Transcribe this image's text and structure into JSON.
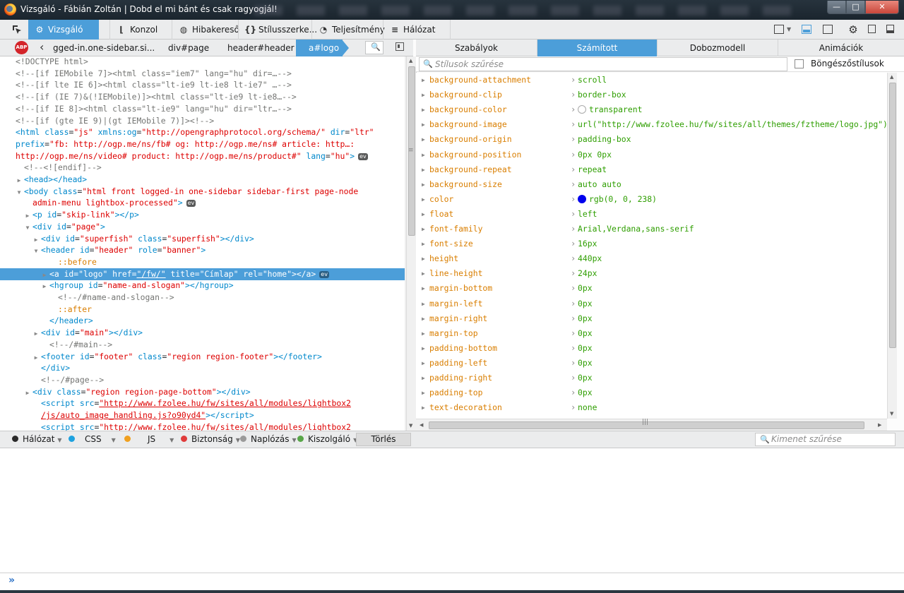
{
  "window": {
    "title": "Vizsgáló - Fábián Zoltán | Dobd el mi bánt és csak ragyogjál!",
    "buttons": {
      "minimize": "—",
      "maximize": "□",
      "close": "✕"
    }
  },
  "toolbar": {
    "tabs": [
      {
        "label": "Vizsgáló",
        "icon": "inspector-icon"
      },
      {
        "label": "Konzol",
        "icon": "console-icon"
      },
      {
        "label": "Hibakereső",
        "icon": "debugger-icon"
      },
      {
        "label": "Stílusszerke...",
        "icon": "style-editor-icon"
      },
      {
        "label": "Teljesítmény",
        "icon": "performance-icon"
      },
      {
        "label": "Hálózat",
        "icon": "network-icon"
      }
    ]
  },
  "breadcrumbs": {
    "items": [
      "gged-in.one-sidebar.si...",
      "div#page",
      "header#header",
      "a#logo"
    ]
  },
  "markup": {
    "lines": [
      {
        "indent": 0,
        "tw": "",
        "html": "<span class=\"cm\">&lt;!DOCTYPE html&gt;</span>"
      },
      {
        "indent": 0,
        "tw": "",
        "html": "<span class=\"cm\">&lt;!--[if IEMobile 7]&gt;&lt;html class=\"iem7\" lang=\"hu\" dir=…--&gt;</span>"
      },
      {
        "indent": 0,
        "tw": "",
        "html": "<span class=\"cm\">&lt;!--[if lte IE 6]&gt;&lt;html class=\"lt-ie9 lt-ie8 lt-ie7\" …--&gt;</span>"
      },
      {
        "indent": 0,
        "tw": "",
        "html": "<span class=\"cm\">&lt;!--[if (IE 7)&amp;(!IEMobile)]&gt;&lt;html class=\"lt-ie9 lt-ie8…--&gt;</span>"
      },
      {
        "indent": 0,
        "tw": "",
        "html": "<span class=\"cm\">&lt;!--[if IE 8]&gt;&lt;html class=\"lt-ie9\" lang=\"hu\" dir=\"ltr…--&gt;</span>"
      },
      {
        "indent": 0,
        "tw": "",
        "html": "<span class=\"cm\">&lt;!--[if (gte IE 9)|(gt IEMobile 7)]&gt;&lt;!--&gt;</span>"
      },
      {
        "indent": 0,
        "tw": "",
        "html": "<span class=\"tag\">&lt;html</span> <span class=\"an\">class</span>=<span class=\"av\">\"js\"</span> <span class=\"an\">xmlns:og</span>=<span class=\"av\">\"http://opengraphprotocol.org/schema/\"</span> <span class=\"an\">dir</span>=<span class=\"av\">\"ltr\"</span>"
      },
      {
        "indent": 0,
        "tw": "",
        "html": "<span class=\"an\">prefix</span>=<span class=\"av\">\"fb: http://ogp.me/ns/fb# og: http://ogp.me/ns# article: http…:</span>"
      },
      {
        "indent": 0,
        "tw": "",
        "html": "<span class=\"av\">http://ogp.me/ns/video# product: http://ogp.me/ns/product#\"</span> <span class=\"an\">lang</span>=<span class=\"av\">\"hu\"</span><span class=\"tag\">&gt;</span><span class=\"ev\">ev</span>"
      },
      {
        "indent": 1,
        "tw": "",
        "html": "<span class=\"cm\">&lt;!--&lt;![endif]--&gt;</span>"
      },
      {
        "indent": 1,
        "tw": "▶",
        "html": "<span class=\"tag\">&lt;head&gt;&lt;/head&gt;</span>"
      },
      {
        "indent": 1,
        "tw": "▼",
        "html": "<span class=\"tag\">&lt;body</span> <span class=\"an\">class</span>=<span class=\"av\">\"html front logged-in one-sidebar sidebar-first page-node</span>"
      },
      {
        "indent": 2,
        "tw": "",
        "html": "<span class=\"av\">admin-menu lightbox-processed\"</span><span class=\"tag\">&gt;</span><span class=\"ev\">ev</span>"
      },
      {
        "indent": 2,
        "tw": "▶",
        "html": "<span class=\"tag\">&lt;p</span> <span class=\"an\">id</span>=<span class=\"av\">\"skip-link\"</span><span class=\"tag\">&gt;&lt;/p&gt;</span>"
      },
      {
        "indent": 2,
        "tw": "▼",
        "html": "<span class=\"tag\">&lt;div</span> <span class=\"an\">id</span>=<span class=\"av\">\"page\"</span><span class=\"tag\">&gt;</span>"
      },
      {
        "indent": 3,
        "tw": "▶",
        "html": "<span class=\"tag\">&lt;div</span> <span class=\"an\">id</span>=<span class=\"av\">\"superfish\"</span> <span class=\"an\">class</span>=<span class=\"av\">\"superfish\"</span><span class=\"tag\">&gt;&lt;/div&gt;</span>"
      },
      {
        "indent": 3,
        "tw": "▼",
        "html": "<span class=\"tag\">&lt;header</span> <span class=\"an\">id</span>=<span class=\"av\">\"header\"</span> <span class=\"an\">role</span>=<span class=\"av\">\"banner\"</span><span class=\"tag\">&gt;</span>"
      },
      {
        "indent": 5,
        "tw": "",
        "html": "<span class=\"pseudo\">::before</span>"
      },
      {
        "indent": 4,
        "tw": "▶",
        "sel": true,
        "html": "<span class=\"tag\">&lt;a</span> <span class=\"an\">id</span>=<span class=\"av\">\"logo\"</span> <span class=\"an\">href</span>=<span class=\"link\">\"/fw/\"</span> <span class=\"an\">title</span>=<span class=\"av\">\"Címlap\"</span> <span class=\"an\">rel</span>=<span class=\"av\">\"home\"</span><span class=\"tag\">&gt;&lt;/a&gt;</span><span class=\"ev\">ev</span>"
      },
      {
        "indent": 4,
        "tw": "▶",
        "html": "<span class=\"tag\">&lt;hgroup</span> <span class=\"an\">id</span>=<span class=\"av\">\"name-and-slogan\"</span><span class=\"tag\">&gt;&lt;/hgroup&gt;</span>"
      },
      {
        "indent": 5,
        "tw": "",
        "html": "<span class=\"cm\">&lt;!--/#name-and-slogan--&gt;</span>"
      },
      {
        "indent": 5,
        "tw": "",
        "html": "<span class=\"pseudo\">::after</span>"
      },
      {
        "indent": 4,
        "tw": "",
        "html": "<span class=\"tag\">&lt;/header&gt;</span>"
      },
      {
        "indent": 3,
        "tw": "▶",
        "html": "<span class=\"tag\">&lt;div</span> <span class=\"an\">id</span>=<span class=\"av\">\"main\"</span><span class=\"tag\">&gt;&lt;/div&gt;</span>"
      },
      {
        "indent": 4,
        "tw": "",
        "html": "<span class=\"cm\">&lt;!--/#main--&gt;</span>"
      },
      {
        "indent": 3,
        "tw": "▶",
        "html": "<span class=\"tag\">&lt;footer</span> <span class=\"an\">id</span>=<span class=\"av\">\"footer\"</span> <span class=\"an\">class</span>=<span class=\"av\">\"region region-footer\"</span><span class=\"tag\">&gt;&lt;/footer&gt;</span>"
      },
      {
        "indent": 3,
        "tw": "",
        "html": "<span class=\"tag\">&lt;/div&gt;</span>"
      },
      {
        "indent": 3,
        "tw": "",
        "html": "<span class=\"cm\">&lt;!--/#page--&gt;</span>"
      },
      {
        "indent": 2,
        "tw": "▶",
        "html": "<span class=\"tag\">&lt;div</span> <span class=\"an\">class</span>=<span class=\"av\">\"region region-page-bottom\"</span><span class=\"tag\">&gt;&lt;/div&gt;</span>"
      },
      {
        "indent": 3,
        "tw": "",
        "html": "<span class=\"tag\">&lt;script</span> <span class=\"an\">src</span>=<span class=\"link\">\"http://www.fzolee.hu/fw/sites/all/modules/lightbox2</span>"
      },
      {
        "indent": 3,
        "tw": "",
        "html": "<span class=\"link\">/js/auto_image_handling.js?o90yd4\"</span><span class=\"tag\">&gt;&lt;/script&gt;</span>"
      },
      {
        "indent": 3,
        "tw": "",
        "html": "<span class=\"tag\">&lt;script</span> <span class=\"an\">src</span>=<span class=\"link\">\"http://www.fzolee.hu/fw/sites/all/modules/lightbox2</span>"
      }
    ]
  },
  "sidebar": {
    "tabs": [
      "Szabályok",
      "Számított",
      "Dobozmodell",
      "Animációk"
    ],
    "filter_placeholder": "Stílusok szűrése",
    "browser_styles_label": "Böngészőstílusok"
  },
  "computed": [
    {
      "name": "background-attachment",
      "value": "scroll"
    },
    {
      "name": "background-clip",
      "value": "border-box"
    },
    {
      "name": "background-color",
      "value": "transparent",
      "swatch": "transparent"
    },
    {
      "name": "background-image",
      "value": "url(\"http://www.fzolee.hu/fw/sites/all/themes/fztheme/logo.jpg\")"
    },
    {
      "name": "background-origin",
      "value": "padding-box"
    },
    {
      "name": "background-position",
      "value": "0px 0px"
    },
    {
      "name": "background-repeat",
      "value": "repeat"
    },
    {
      "name": "background-size",
      "value": "auto auto"
    },
    {
      "name": "color",
      "value": "rgb(0, 0, 238)",
      "swatch": "#0000ee"
    },
    {
      "name": "float",
      "value": "left"
    },
    {
      "name": "font-family",
      "value": "Arial,Verdana,sans-serif"
    },
    {
      "name": "font-size",
      "value": "16px"
    },
    {
      "name": "height",
      "value": "440px"
    },
    {
      "name": "line-height",
      "value": "24px"
    },
    {
      "name": "margin-bottom",
      "value": "0px"
    },
    {
      "name": "margin-left",
      "value": "0px"
    },
    {
      "name": "margin-right",
      "value": "0px"
    },
    {
      "name": "margin-top",
      "value": "0px"
    },
    {
      "name": "padding-bottom",
      "value": "0px"
    },
    {
      "name": "padding-left",
      "value": "0px"
    },
    {
      "name": "padding-right",
      "value": "0px"
    },
    {
      "name": "padding-top",
      "value": "0px"
    },
    {
      "name": "text-decoration",
      "value": "none"
    }
  ],
  "console": {
    "filters": [
      {
        "label": "Hálózat",
        "color": "#2a2a2a"
      },
      {
        "label": "CSS",
        "color": "#1ea2df"
      },
      {
        "label": "JS",
        "color": "#f0a020"
      },
      {
        "label": "Biztonság",
        "color": "#e03b3b"
      },
      {
        "label": "Naplózás",
        "color": "#9a9a9a"
      },
      {
        "label": "Kiszolgáló",
        "color": "#58a648"
      }
    ],
    "clear_label": "Törlés",
    "output_filter_placeholder": "Kimenet szűrése",
    "prompt": "»"
  },
  "icons": {
    "abp": "ABP",
    "search": "🔍",
    "back": "‹"
  }
}
